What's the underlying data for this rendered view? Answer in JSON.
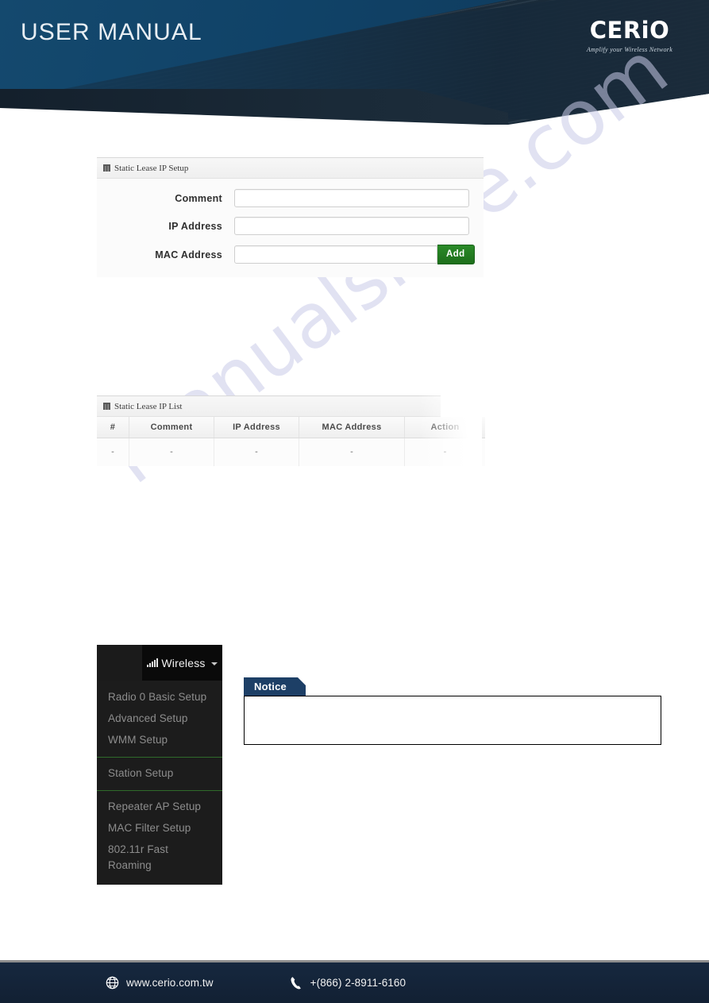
{
  "header": {
    "title": "USER MANUAL",
    "brand_name": "CERiO",
    "brand_tagline": "Amplify your Wireless Network",
    "bg_color": "#14496e",
    "stripe_color": "#1d3040"
  },
  "watermark": {
    "text": "manualshive.com",
    "color": "#c9cbe8"
  },
  "setup_panel": {
    "title": "Static Lease IP Setup",
    "title_icon": "grid-icon",
    "fields": [
      {
        "label": "Comment",
        "value": "",
        "placeholder": ""
      },
      {
        "label": "IP Address",
        "value": "",
        "placeholder": ""
      },
      {
        "label": "MAC Address",
        "value": "",
        "placeholder": ""
      }
    ],
    "add_button": {
      "label": "Add",
      "color": "#1f7a1f"
    }
  },
  "list_panel": {
    "title": "Static Lease IP List",
    "title_icon": "grid-icon",
    "columns": [
      "#",
      "Comment",
      "IP Address",
      "MAC Address",
      "Action"
    ],
    "rows": [
      [
        "-",
        "-",
        "-",
        "-",
        "-"
      ]
    ]
  },
  "wireless_menu": {
    "header_label": "Wireless",
    "header_icon": "signal-bars-icon",
    "caret_icon": "chevron-down-icon",
    "groups": [
      {
        "items": [
          "Radio 0 Basic Setup",
          "Advanced Setup",
          "WMM Setup"
        ]
      },
      {
        "items": [
          "Station Setup"
        ]
      },
      {
        "items": [
          "Repeater AP Setup",
          "MAC Filter Setup",
          "802.11r Fast Roaming"
        ]
      }
    ],
    "divider_color": "#2f6b2a"
  },
  "notice": {
    "label": "Notice",
    "body_text": "",
    "tab_color": "#1d3f66"
  },
  "footer": {
    "website": "www.cerio.com.tw",
    "website_icon": "globe-icon",
    "phone": "+(866) 2-8911-6160",
    "phone_icon": "phone-icon",
    "bg_color": "#14243a"
  }
}
